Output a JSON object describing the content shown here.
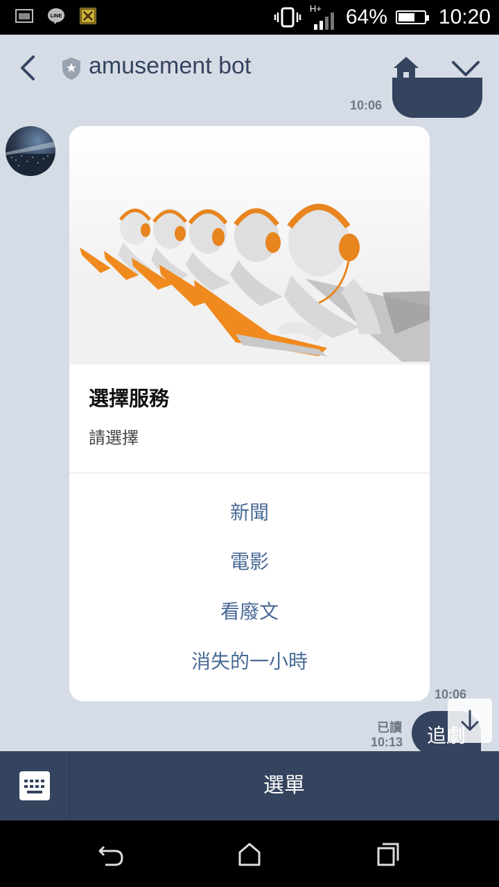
{
  "status_bar": {
    "network": "H+",
    "battery_text": "64%",
    "battery_level": 0.64,
    "time": "10:20",
    "icons": [
      "image-notification-icon",
      "line-app-icon",
      "game-notification-icon",
      "vibrate-icon",
      "signal-icon",
      "battery-icon"
    ]
  },
  "header": {
    "title": "amusement bot",
    "icons": [
      "back-icon",
      "official-shield-icon",
      "home-icon",
      "chevron-down-icon"
    ]
  },
  "messages": {
    "previous": {
      "time": "10:06"
    },
    "card": {
      "title": "選擇服務",
      "subtitle": "請選擇",
      "actions": [
        "新聞",
        "電影",
        "看廢文",
        "消失的一小時"
      ],
      "time": "10:06"
    },
    "sent": {
      "text": "追劇",
      "read_label": "已讀",
      "time": "10:13"
    }
  },
  "menu_bar": {
    "label": "選單",
    "keyboard_icon": "keyboard-icon"
  },
  "nav_bar": {
    "icons": [
      "nav-back-icon",
      "nav-home-icon",
      "nav-recents-icon"
    ]
  },
  "colors": {
    "accent": "#34435e",
    "background": "#d6dce5",
    "link": "#486a96",
    "headset_orange": "#e8851f"
  }
}
